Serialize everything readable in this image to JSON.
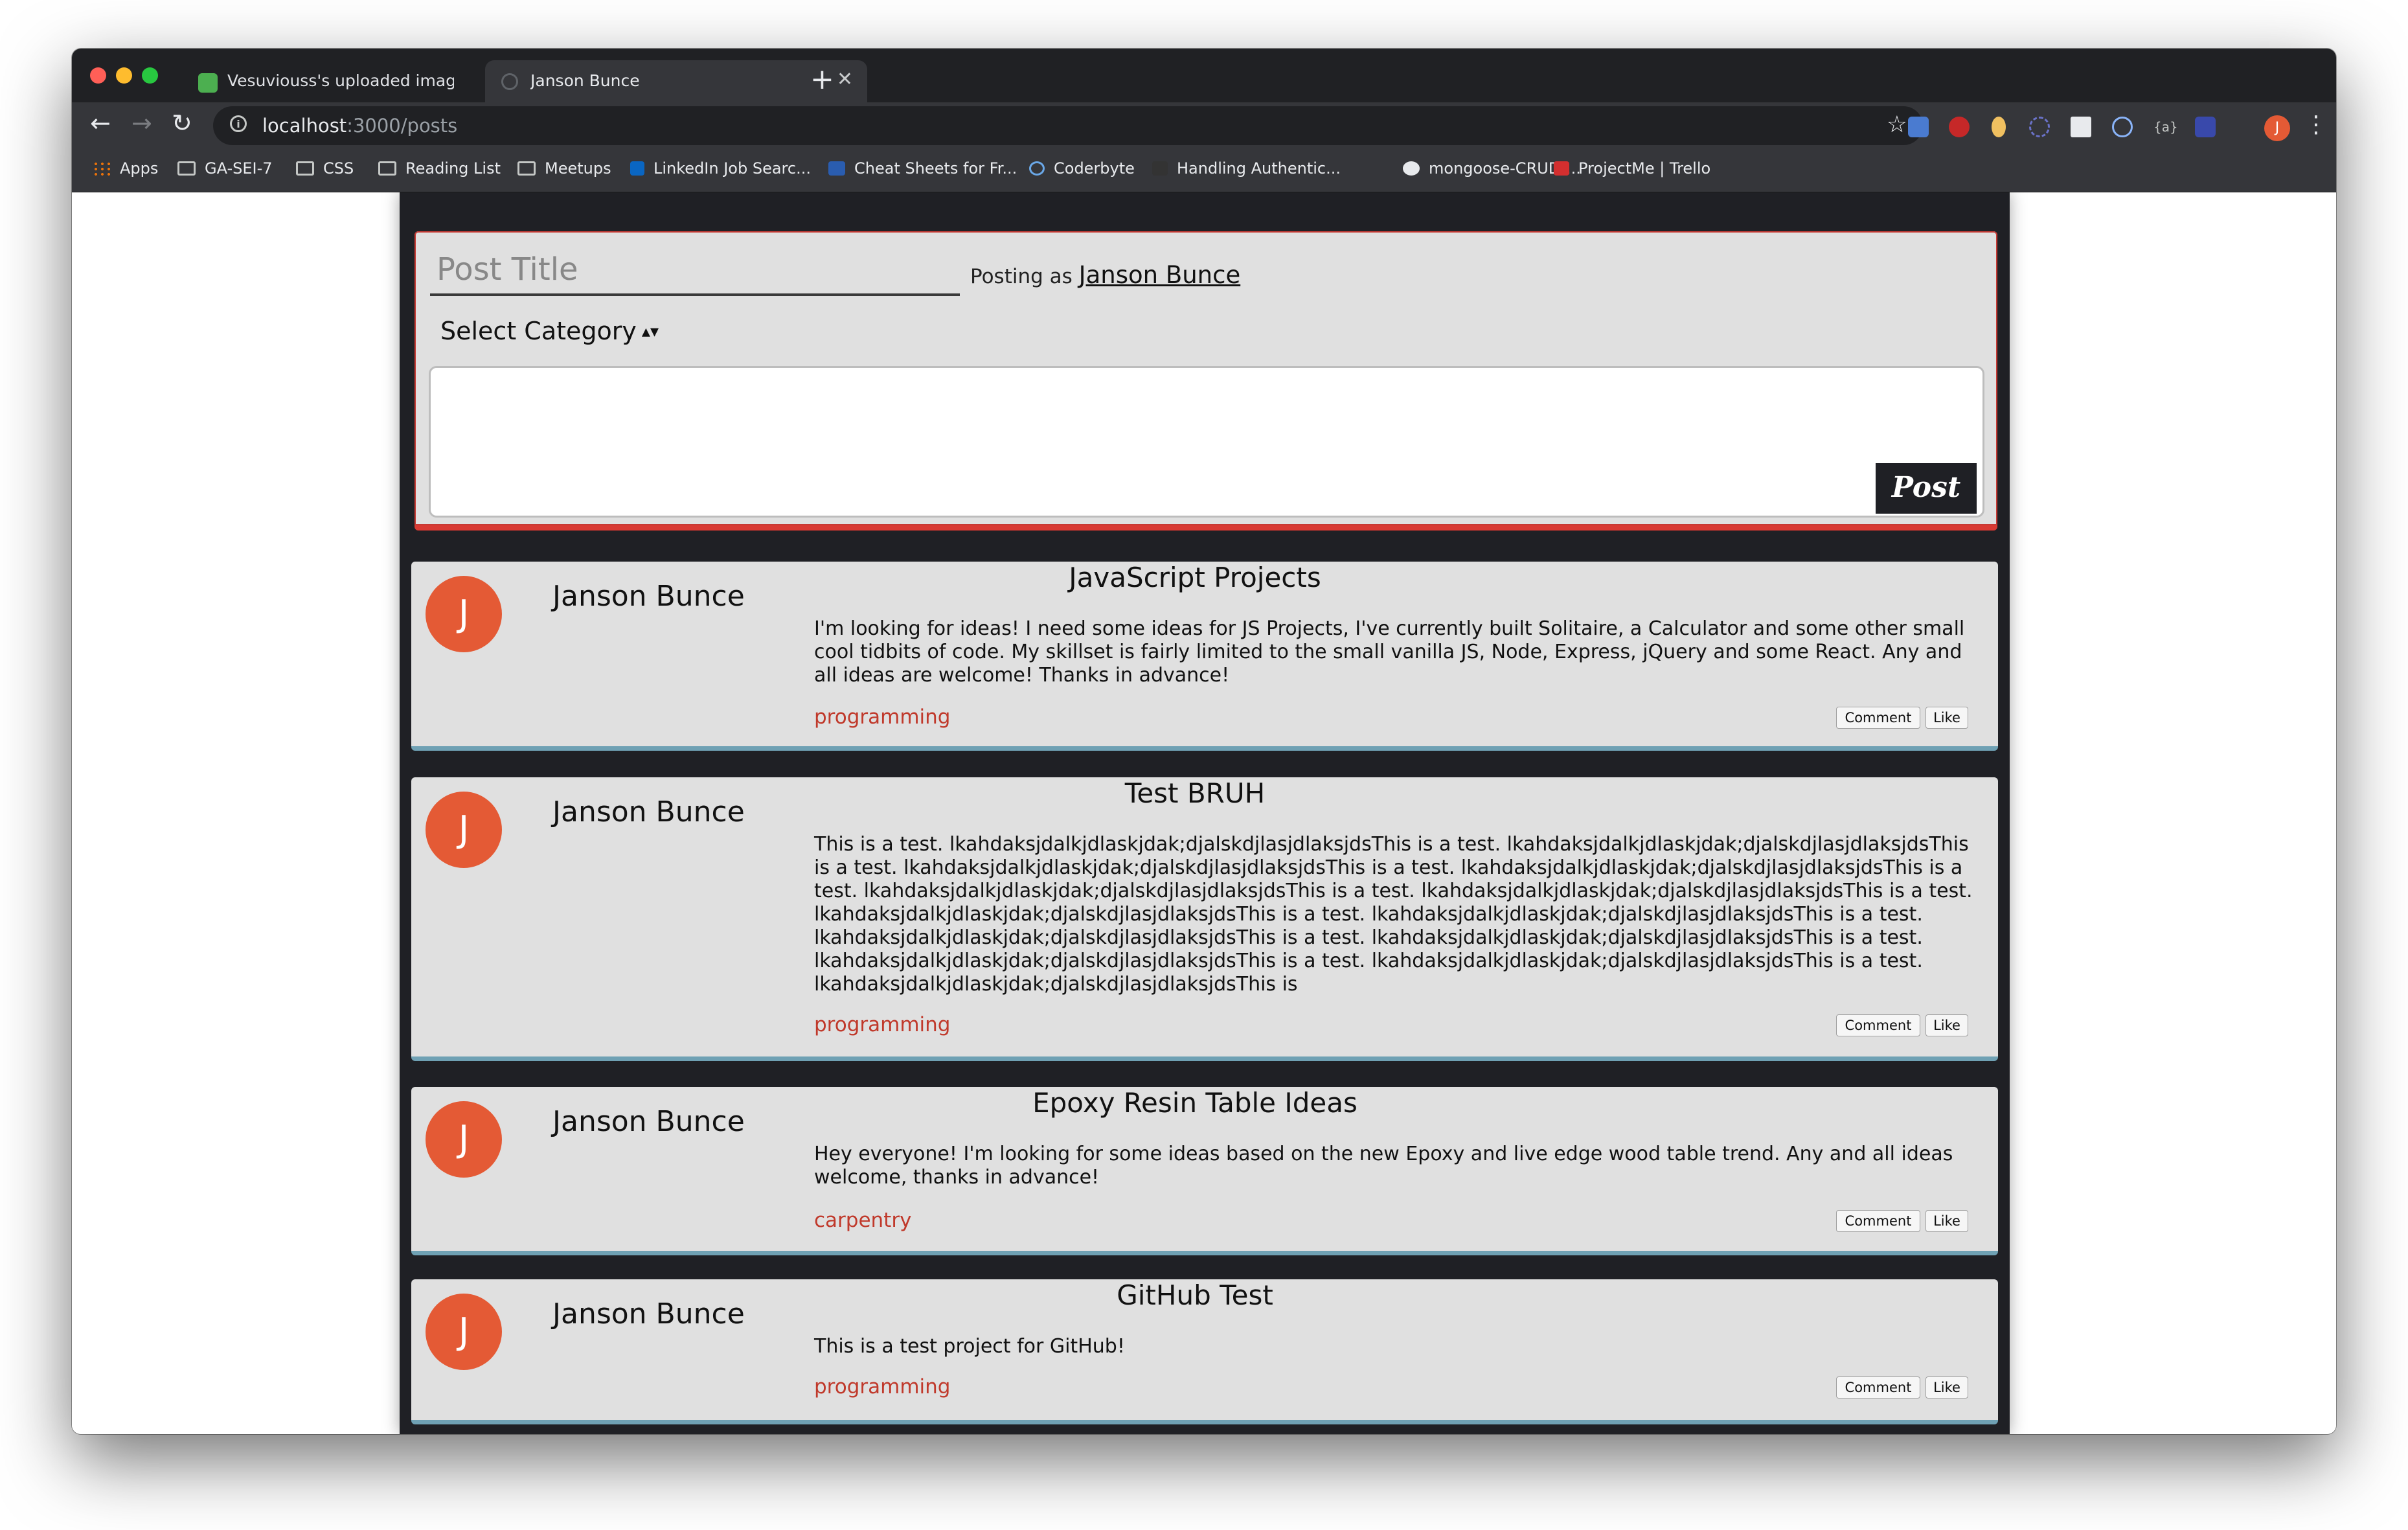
{
  "browser": {
    "tabs": [
      {
        "title": "Vesuviouss's uploaded images -",
        "active": false
      },
      {
        "title": "Janson Bunce",
        "active": true
      }
    ],
    "url_host": "localhost",
    "url_path": ":3000/posts",
    "profile_initial": "J",
    "bookmarks": [
      {
        "label": "Apps",
        "icon": "apps-icon"
      },
      {
        "label": "GA-SEI-7",
        "icon": "folder-icon"
      },
      {
        "label": "CSS",
        "icon": "folder-icon"
      },
      {
        "label": "Reading List",
        "icon": "folder-icon"
      },
      {
        "label": "Meetups",
        "icon": "folder-icon"
      },
      {
        "label": "LinkedIn Job Searc...",
        "icon": "linkedin-icon"
      },
      {
        "label": "Cheat Sheets for Fr...",
        "icon": "fx-icon"
      },
      {
        "label": "Coderbyte",
        "icon": "coderbyte-icon"
      },
      {
        "label": "Handling Authentic...",
        "icon": "scotch-icon"
      },
      {
        "label": "mongoose-CRUD-...",
        "icon": "github-icon"
      },
      {
        "label": "ProjectMe | Trello",
        "icon": "trello-icon"
      }
    ]
  },
  "composer": {
    "title_placeholder": "Post Title",
    "posting_as_label": "Posting as",
    "posting_as_name": "Janson Bunce",
    "category_label": "Select Category",
    "post_button": "Post"
  },
  "posts": [
    {
      "avatar_initial": "J",
      "author": "Janson Bunce",
      "title": "JavaScript Projects",
      "body": "I'm looking for ideas! I need some ideas for JS Projects, I've currently built Solitaire, a Calculator and some other small cool tidbits of code. My skillset is fairly limited to the small vanilla JS, Node, Express, jQuery and some React. Any and all ideas are welcome! Thanks in advance!",
      "category": "programming",
      "comment_label": "Comment",
      "like_label": "Like"
    },
    {
      "avatar_initial": "J",
      "author": "Janson Bunce",
      "title": "Test BRUH",
      "body": "This is a test. lkahdaksjdalkjdlaskjdak;djalskdjlasjdlaksjdsThis is a test. lkahdaksjdalkjdlaskjdak;djalskdjlasjdlaksjdsThis is a test. lkahdaksjdalkjdlaskjdak;djalskdjlasjdlaksjdsThis is a test. lkahdaksjdalkjdlaskjdak;djalskdjlasjdlaksjdsThis is a test. lkahdaksjdalkjdlaskjdak;djalskdjlasjdlaksjdsThis is a test. lkahdaksjdalkjdlaskjdak;djalskdjlasjdlaksjdsThis is a test. lkahdaksjdalkjdlaskjdak;djalskdjlasjdlaksjdsThis is a test. lkahdaksjdalkjdlaskjdak;djalskdjlasjdlaksjdsThis is a test. lkahdaksjdalkjdlaskjdak;djalskdjlasjdlaksjdsThis is a test. lkahdaksjdalkjdlaskjdak;djalskdjlasjdlaksjdsThis is a test. lkahdaksjdalkjdlaskjdak;djalskdjlasjdlaksjdsThis is a test. lkahdaksjdalkjdlaskjdak;djalskdjlasjdlaksjdsThis is a test. lkahdaksjdalkjdlaskjdak;djalskdjlasjdlaksjdsThis is",
      "category": "programming",
      "comment_label": "Comment",
      "like_label": "Like"
    },
    {
      "avatar_initial": "J",
      "author": "Janson Bunce",
      "title": "Epoxy Resin Table Ideas",
      "body": "Hey everyone! I'm looking for some ideas based on the new Epoxy and live edge wood table trend. Any and all ideas welcome, thanks in advance!",
      "category": "carpentry",
      "comment_label": "Comment",
      "like_label": "Like"
    },
    {
      "avatar_initial": "J",
      "author": "Janson Bunce",
      "title": "GitHub Test",
      "body": "This is a test project for GitHub!",
      "category": "programming",
      "comment_label": "Comment",
      "like_label": "Like"
    }
  ],
  "colors": {
    "accent_red": "#d93a33",
    "avatar_orange": "#e45a35",
    "card_bottom_border": "#6fa1b4",
    "category_text": "#c0392b",
    "page_dark": "#1f2025"
  }
}
